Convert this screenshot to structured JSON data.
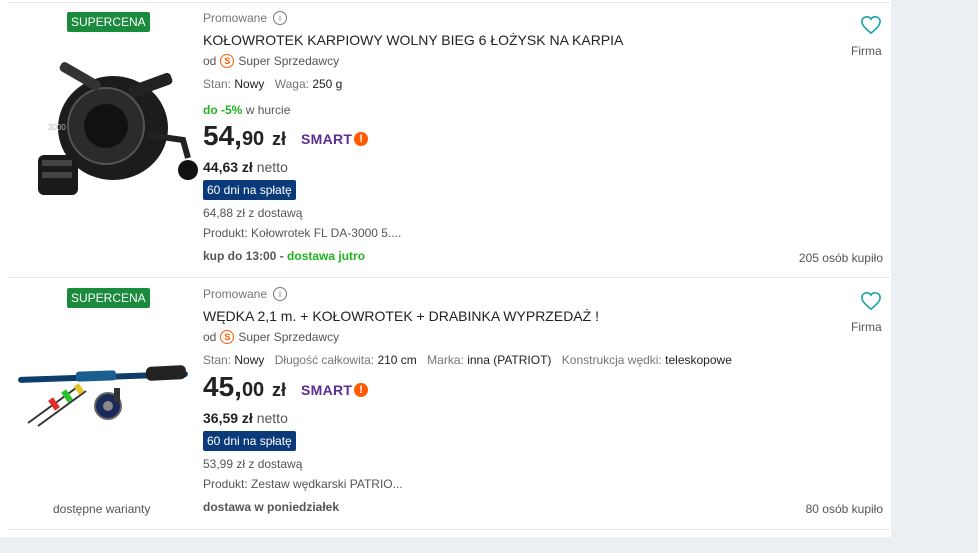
{
  "offers": [
    {
      "badge": "SUPERCENA",
      "promo_label": "Promowane",
      "title": "KOŁOWROTEK KARPIOWY WOLNY BIEG 6 ŁOŻYSK NA KARPIA",
      "seller_prefix": "od",
      "seller_name": "Super Sprzedawcy",
      "params": [
        {
          "label": "Stan:",
          "value": "Nowy"
        },
        {
          "label": "Waga:",
          "value": "250 g"
        }
      ],
      "bulk_discount": "do -5%",
      "bulk_suffix": "w hurcie",
      "price_int": "54,",
      "price_cents": "90",
      "currency": "zł",
      "smart_label": "SMART",
      "net_price": "44,63 zł",
      "net_suffix": "netto",
      "installment": "60 dni na spłatę",
      "with_delivery": "64,88 zł z dostawą",
      "product": "Produkt: Kołowrotek FL DA-3000 5....",
      "shipping_prefix": "kup do 13:00 - ",
      "shipping_highlight": "dostawa jutro",
      "firma": "Firma",
      "bought": "205 osób kupiło"
    },
    {
      "badge": "SUPERCENA",
      "promo_label": "Promowane",
      "title": "WĘDKA 2,1 m. + KOŁOWROTEK + DRABINKA WYPRZEDAŻ !",
      "seller_prefix": "od",
      "seller_name": "Super Sprzedawcy",
      "params": [
        {
          "label": "Stan:",
          "value": "Nowy"
        },
        {
          "label": "Długość całkowita:",
          "value": "210 cm"
        },
        {
          "label": "Marka:",
          "value": "inna (PATRIOT)"
        },
        {
          "label": "Konstrukcja wędki:",
          "value": "teleskopowe"
        }
      ],
      "price_int": "45,",
      "price_cents": "00",
      "currency": "zł",
      "smart_label": "SMART",
      "net_price": "36,59 zł",
      "net_suffix": "netto",
      "installment": "60 dni na spłatę",
      "with_delivery": "53,99 zł z dostawą",
      "product": "Produkt: Zestaw wędkarski PATRIO...",
      "shipping_text": "dostawa w poniedziałek",
      "variants": "dostępne warianty",
      "firma": "Firma",
      "bought": "80 osób kupiło"
    }
  ],
  "icons": {
    "info": "info-icon",
    "seller": "super-seller-icon",
    "smart": "smart-icon",
    "favorite": "heart-icon"
  },
  "colors": {
    "supercena": "#1a8b3c",
    "installment": "#0b3a7a",
    "smart": "#5c2d91",
    "accent": "#ff5a00",
    "green_text": "#1fb41f"
  }
}
